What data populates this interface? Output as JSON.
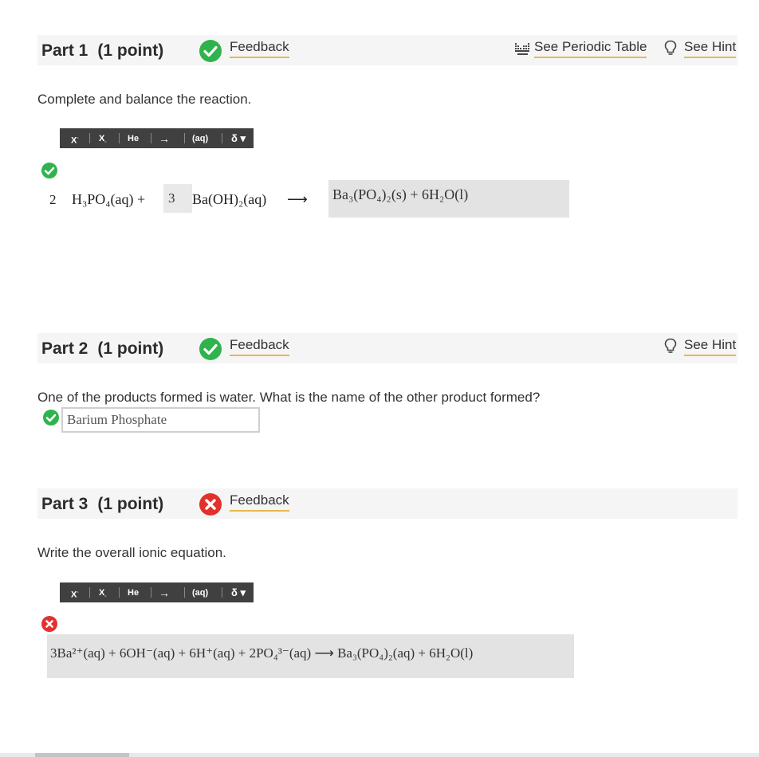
{
  "part1": {
    "title": "Part 1",
    "points": "(1 point)",
    "feedback": "Feedback",
    "periodic_table": "See Periodic Table",
    "hint": "See Hint",
    "prompt": "Complete and balance the reaction.",
    "coef1": "2",
    "reactant1": "H₃PO₄(aq) +",
    "coef2": "3",
    "reactant2": "Ba(OH)₂(aq)",
    "arrow": "⟶",
    "answer": "Ba₃(PO₄)₂(s) + 6H₂O(l)"
  },
  "toolbar": {
    "superscript": "X",
    "subscript": "X",
    "element": "He",
    "arrow": "→",
    "state": "(aq)",
    "delta": "δ"
  },
  "part2": {
    "title": "Part 2",
    "points": "(1 point)",
    "feedback": "Feedback",
    "hint": "See Hint",
    "prompt": "One of the products formed is water. What is the name of the other product formed?",
    "answer": "Barium Phosphate"
  },
  "part3": {
    "title": "Part 3",
    "points": "(1 point)",
    "feedback": "Feedback",
    "prompt": "Write the overall ionic equation.",
    "answer": "3Ba²⁺(aq) + 6OH⁻(aq) + 6H⁺(aq) + 2PO₄³⁻(aq) ⟶ Ba₃(PO₄)₂(aq) + 6H₂O(l)"
  },
  "colors": {
    "correct": "#2fb34c",
    "incorrect": "#e2312d",
    "link_underline": "#e8b84a",
    "toolbar_bg": "#404040"
  }
}
